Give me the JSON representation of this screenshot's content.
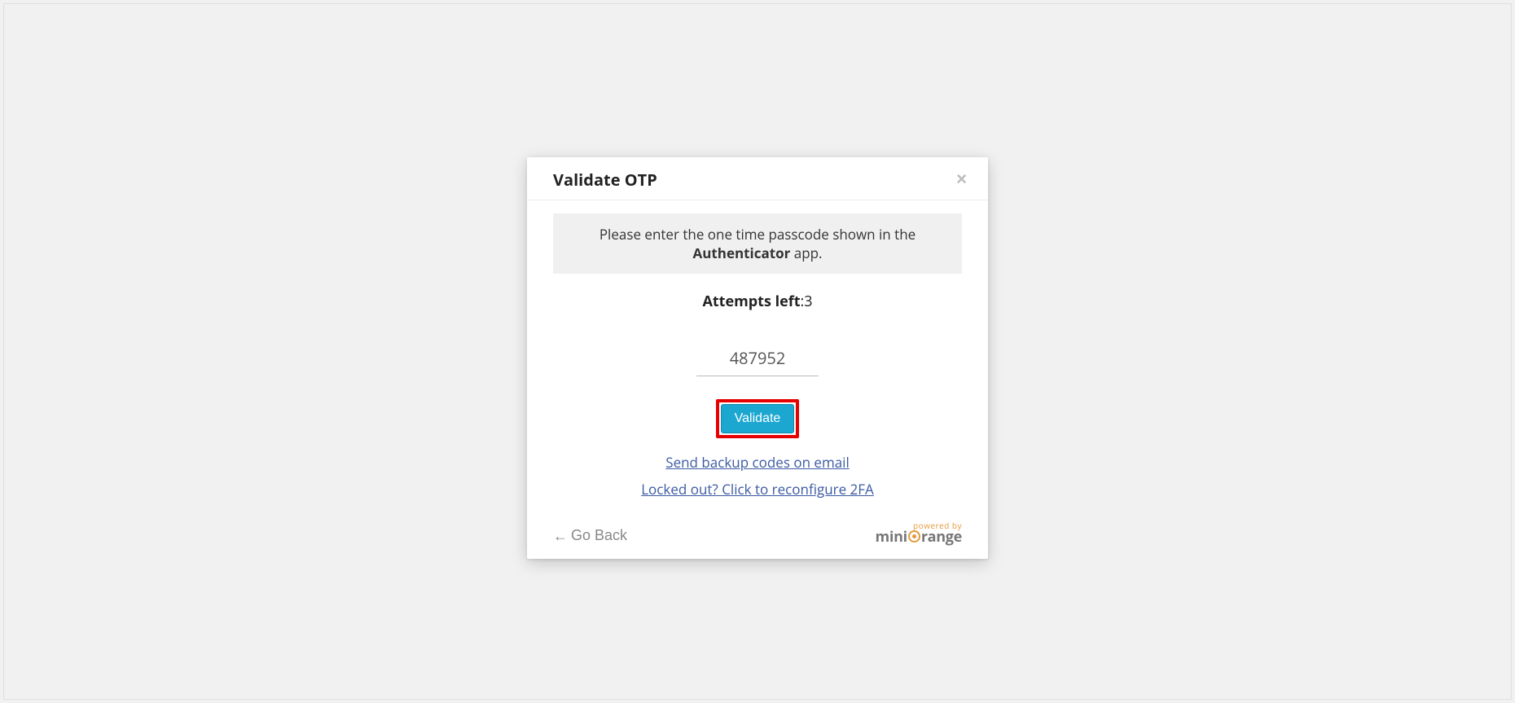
{
  "modal": {
    "title": "Validate OTP",
    "instruction_prefix": "Please enter the one time passcode shown in the ",
    "instruction_app": "Authenticator",
    "instruction_suffix": " app.",
    "attempts_label": "Attempts left",
    "attempts_sep": ":",
    "attempts_value": "3",
    "otp_value": "487952",
    "otp_placeholder": "",
    "validate_button": "Validate",
    "backup_link": "Send backup codes on email",
    "lockout_link": "Locked out? Click to reconfigure 2FA",
    "go_back": "Go Back",
    "close_symbol": "×",
    "arrow_symbol": "←"
  },
  "branding": {
    "powered_by": "powered by",
    "logo_mini": "mini",
    "logo_range": "range"
  },
  "colors": {
    "accent_button": "#1ca7d0",
    "highlight_border": "#e60000",
    "link": "#3b5aa3",
    "brand_orange": "#e39a3c"
  }
}
